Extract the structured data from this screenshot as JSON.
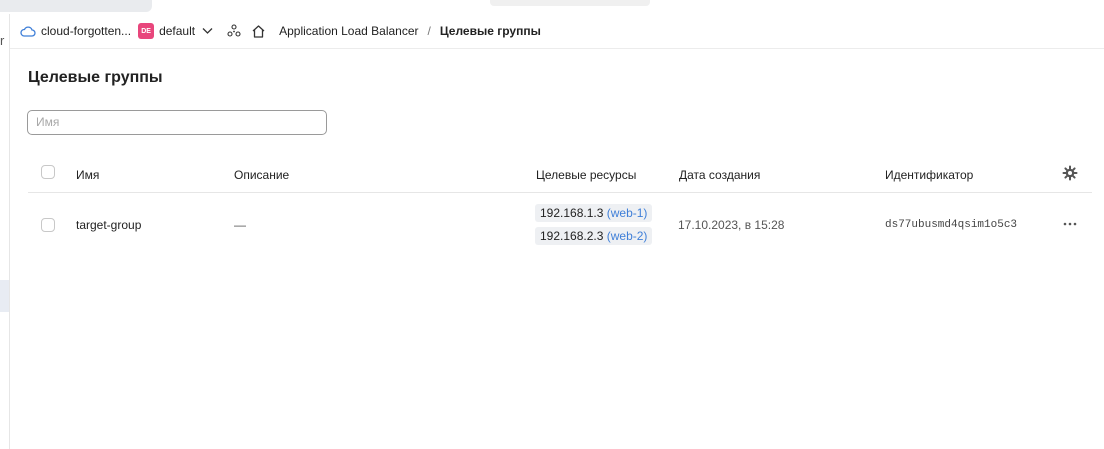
{
  "header": {
    "cloud_name": "cloud-forgotten...",
    "folder_badge": "DE",
    "folder_name": "default",
    "breadcrumb_service": "Application Load Balancer",
    "breadcrumb_separator": "/",
    "breadcrumb_current": "Целевые группы"
  },
  "page": {
    "title": "Целевые группы",
    "search_placeholder": "Имя"
  },
  "table": {
    "columns": {
      "name": "Имя",
      "description": "Описание",
      "targets": "Целевые ресурсы",
      "created": "Дата создания",
      "id": "Идентификатор"
    },
    "rows": [
      {
        "name": "target-group",
        "description": "—",
        "targets": [
          {
            "ip": "192.168.1.3",
            "vm": "(web-1)"
          },
          {
            "ip": "192.168.2.3",
            "vm": "(web-2)"
          }
        ],
        "created": "17.10.2023, в 15:28",
        "id": "ds77ubusmd4qsim1o5c3"
      }
    ]
  },
  "left_edge_glyph": "r",
  "colors": {
    "accent": "#3f7fd8",
    "folder_badge": "#e8467c"
  }
}
